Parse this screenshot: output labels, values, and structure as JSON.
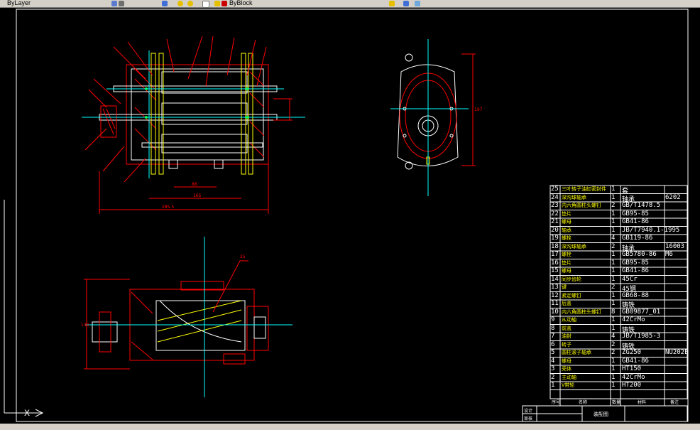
{
  "toolbar": {
    "left_text": "ByLayer",
    "right_text": "ByBlock"
  },
  "colors": {
    "background": "#000000",
    "drawing_red": "#ff0000",
    "drawing_white": "#ffffff",
    "center_cyan": "#00ffff",
    "table_yellow": "#ffff00"
  },
  "parts_table": [
    {
      "no": "25",
      "name": "三叶转子油缸密封件",
      "qty": "1",
      "std": "套",
      "rem": ""
    },
    {
      "no": "24",
      "name": "深沟球轴承",
      "qty": "1",
      "std": "轴承",
      "rem": "6202"
    },
    {
      "no": "23",
      "name": "内六角圆柱头螺钉",
      "qty": "2",
      "std": "GB/T1478.5",
      "rem": ""
    },
    {
      "no": "22",
      "name": "垫片",
      "qty": "1",
      "std": "GB95-85",
      "rem": ""
    },
    {
      "no": "21",
      "name": "螺母",
      "qty": "1",
      "std": "GB41-86",
      "rem": ""
    },
    {
      "no": "20",
      "name": "轴承",
      "qty": "1",
      "std": "JB/T7940.1-1995",
      "rem": ""
    },
    {
      "no": "19",
      "name": "螺栓",
      "qty": "4",
      "std": "GB119-86",
      "rem": ""
    },
    {
      "no": "18",
      "name": "深沟球轴承",
      "qty": "2",
      "std": "轴承",
      "rem": "16003"
    },
    {
      "no": "17",
      "name": "螺栓",
      "qty": "1",
      "std": "GB5780-86",
      "rem": "M6"
    },
    {
      "no": "16",
      "name": "垫片",
      "qty": "1",
      "std": "GB95-85",
      "rem": ""
    },
    {
      "no": "15",
      "name": "螺母",
      "qty": "1",
      "std": "GB41-86",
      "rem": ""
    },
    {
      "no": "14",
      "name": "同步齿轮",
      "qty": "1",
      "std": "45Cr",
      "rem": ""
    },
    {
      "no": "13",
      "name": "键",
      "qty": "2",
      "std": "45钢",
      "rem": ""
    },
    {
      "no": "12",
      "name": "紧定螺钉",
      "qty": "1",
      "std": "GB68-88",
      "rem": ""
    },
    {
      "no": "11",
      "name": "后盖",
      "qty": "1",
      "std": "铸铁",
      "rem": ""
    },
    {
      "no": "10",
      "name": "内六角圆柱头螺钉",
      "qty": "8",
      "std": "GB09877_01",
      "rem": ""
    },
    {
      "no": "9",
      "name": "从动轴",
      "qty": "1",
      "std": "42CrMo",
      "rem": ""
    },
    {
      "no": "8",
      "name": "前盖",
      "qty": "1",
      "std": "铸铁",
      "rem": ""
    },
    {
      "no": "7",
      "name": "油封",
      "qty": "4",
      "std": "JB/T1985-3",
      "rem": ""
    },
    {
      "no": "6",
      "name": "转子",
      "qty": "2",
      "std": "铸铁",
      "rem": ""
    },
    {
      "no": "5",
      "name": "圆柱滚子轴承",
      "qty": "2",
      "std": "ZG250",
      "rem": "NU202E"
    },
    {
      "no": "4",
      "name": "螺母",
      "qty": "1",
      "std": "GB41-86",
      "rem": ""
    },
    {
      "no": "3",
      "name": "壳体",
      "qty": "1",
      "std": "HT150",
      "rem": ""
    },
    {
      "no": "2",
      "name": "主动轴",
      "qty": "1",
      "std": "42CrMo",
      "rem": ""
    },
    {
      "no": "1",
      "name": "V带轮",
      "qty": "1",
      "std": "HT200",
      "rem": ""
    }
  ],
  "table_header": {
    "no": "序号",
    "name": "名称",
    "qty": "数量",
    "std": "材料",
    "rem": "备注"
  },
  "title_block": {
    "label_design": "设计",
    "label_check": "审核",
    "drawing_name": "装配图"
  },
  "dims": {
    "top_length": "285.5",
    "top_inner": "165",
    "top_span": "88",
    "side_height": "197",
    "bottom_height": "140",
    "callout_bottom": "25"
  },
  "ucs_label": "X"
}
